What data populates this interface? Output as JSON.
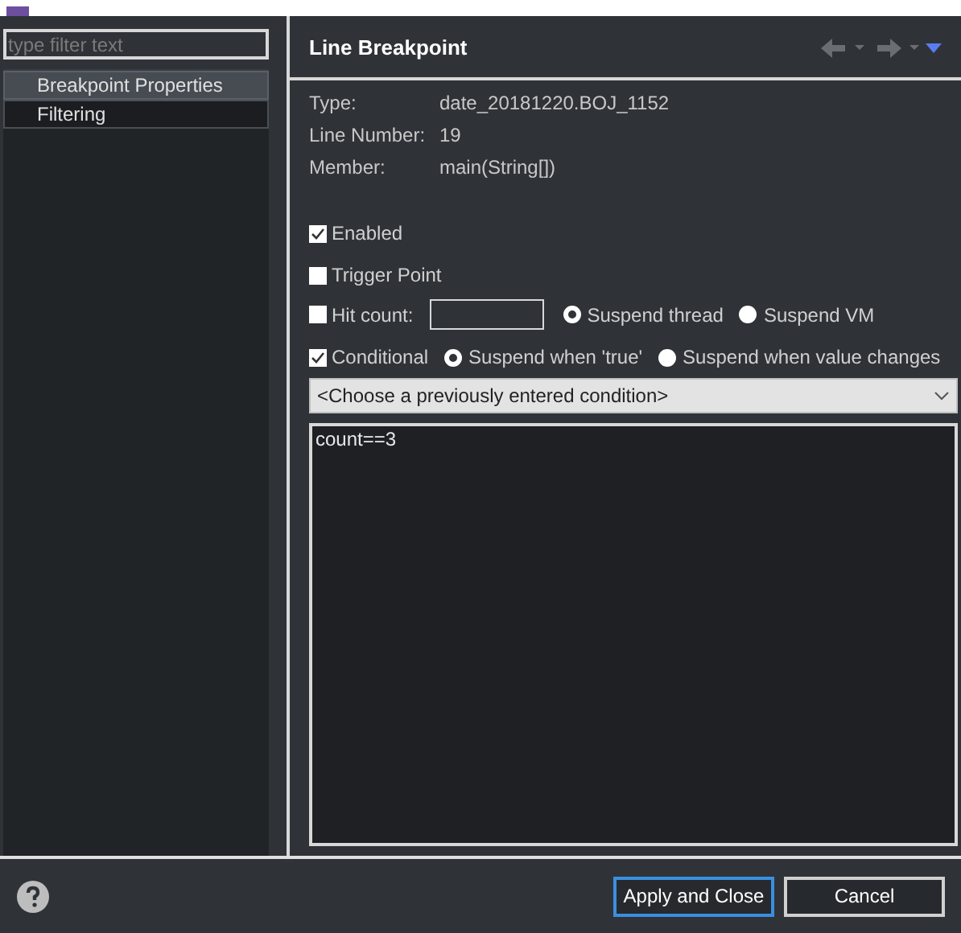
{
  "filter": {
    "placeholder": "type filter text"
  },
  "nav": [
    {
      "label": "Breakpoint Properties",
      "selected": true
    },
    {
      "label": "Filtering",
      "selected": false
    }
  ],
  "page_title": "Line Breakpoint",
  "info": [
    {
      "label": "Type:",
      "value": "date_20181220.BOJ_1152"
    },
    {
      "label": "Line Number:",
      "value": "19"
    },
    {
      "label": "Member:",
      "value": "main(String[])"
    }
  ],
  "enabled": {
    "label": "Enabled",
    "checked": true
  },
  "trigger": {
    "label": "Trigger Point",
    "checked": false
  },
  "hit_count": {
    "label": "Hit count:",
    "checked": false
  },
  "suspend": [
    {
      "label": "Suspend thread",
      "selected": true
    },
    {
      "label": "Suspend VM",
      "selected": false
    }
  ],
  "conditional": {
    "label": "Conditional",
    "checked": true
  },
  "condition_mode": [
    {
      "label": "Suspend when 'true'",
      "selected": true
    },
    {
      "label": "Suspend when value changes",
      "selected": false
    }
  ],
  "condition_history": "<Choose a previously entered condition>",
  "condition": "count==3",
  "buttons": [
    {
      "label": "Apply and Close",
      "default": true
    },
    {
      "label": "Cancel",
      "default": false
    }
  ]
}
